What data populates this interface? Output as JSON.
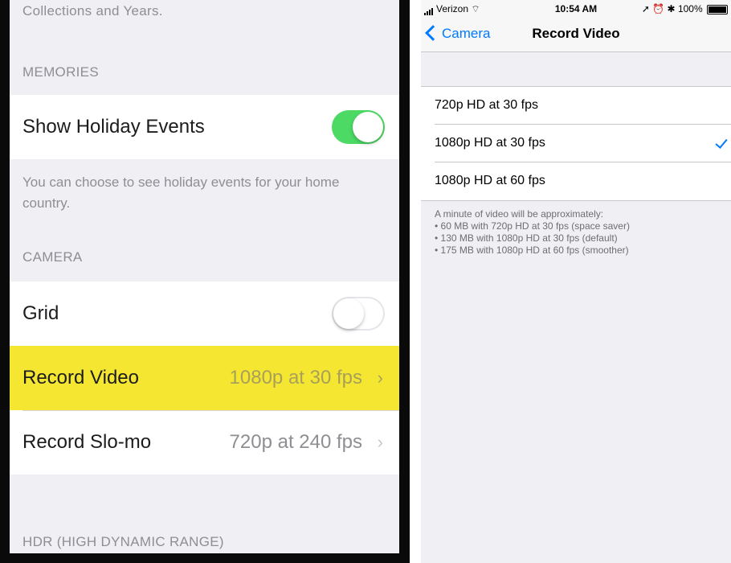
{
  "left": {
    "cut_text": "Collections and Years.",
    "memories_header": "MEMORIES",
    "holiday_label": "Show Holiday Events",
    "holiday_toggle": "on",
    "holiday_footer": "You can choose to see holiday events for your home country.",
    "camera_header": "CAMERA",
    "grid_label": "Grid",
    "grid_toggle": "off",
    "record_video_label": "Record Video",
    "record_video_value": "1080p at 30 fps",
    "record_slomo_label": "Record Slo-mo",
    "record_slomo_value": "720p at 240 fps",
    "hdr_header": "HDR (HIGH DYNAMIC RANGE)",
    "highlight_color": "#f5e731",
    "toggle_on_color": "#4cd964"
  },
  "right": {
    "status": {
      "carrier": "Verizon",
      "time": "10:54 AM",
      "battery": "100%"
    },
    "nav": {
      "back_label": "Camera",
      "title": "Record Video"
    },
    "options": [
      {
        "label": "720p HD at 30 fps",
        "selected": false
      },
      {
        "label": "1080p HD at 30 fps",
        "selected": true
      },
      {
        "label": "1080p HD at 60 fps",
        "selected": false
      }
    ],
    "footer": {
      "intro": "A minute of video will be approximately:",
      "lines": [
        "• 60 MB with 720p HD at 30 fps (space saver)",
        "• 130 MB with 1080p HD at 30 fps (default)",
        "• 175 MB with 1080p HD at 60 fps (smoother)"
      ]
    },
    "accent_color": "#007aff"
  }
}
